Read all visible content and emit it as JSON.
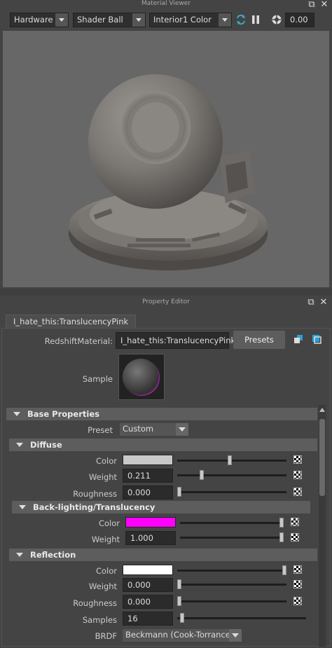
{
  "material_viewer": {
    "title": "Material Viewer",
    "renderer": "Hardware",
    "shape": "Shader Ball",
    "environment": "Interior1 Color",
    "exposure": "0.00",
    "background_color": "#676767"
  },
  "property_editor": {
    "title": "Property Editor",
    "tab_label": "I_hate_this:TranslucencyPink",
    "type_label": "RedshiftMaterial:",
    "material_name": "I_hate_this:TranslucencyPink",
    "presets_label": "Presets",
    "sample_label": "Sample",
    "base_properties": {
      "header": "Base Properties",
      "preset_label": "Preset",
      "preset_value": "Custom"
    },
    "diffuse": {
      "header": "Diffuse",
      "color_label": "Color",
      "color": "#c8c8c8",
      "weight_label": "Weight",
      "weight": "0.211",
      "weight_fraction": 0.211,
      "roughness_label": "Roughness",
      "roughness": "0.000",
      "roughness_fraction": 0.0,
      "color_slider_fraction": 0.48
    },
    "backlighting": {
      "header": "Back-lighting/Translucency",
      "color_label": "Color",
      "color": "#ff00ff",
      "color_slider_fraction": 1.0,
      "weight_label": "Weight",
      "weight": "1.000",
      "weight_fraction": 1.0
    },
    "reflection": {
      "header": "Reflection",
      "color_label": "Color",
      "color": "#ffffff",
      "color_slider_fraction": 1.0,
      "weight_label": "Weight",
      "weight": "0.000",
      "weight_fraction": 0.0,
      "roughness_label": "Roughness",
      "roughness": "0.000",
      "roughness_fraction": 0.0,
      "samples_label": "Samples",
      "samples": "16",
      "samples_fraction": 0.02,
      "brdf_label": "BRDF",
      "brdf_value": "Beckmann (Cook-Torrance)"
    }
  }
}
